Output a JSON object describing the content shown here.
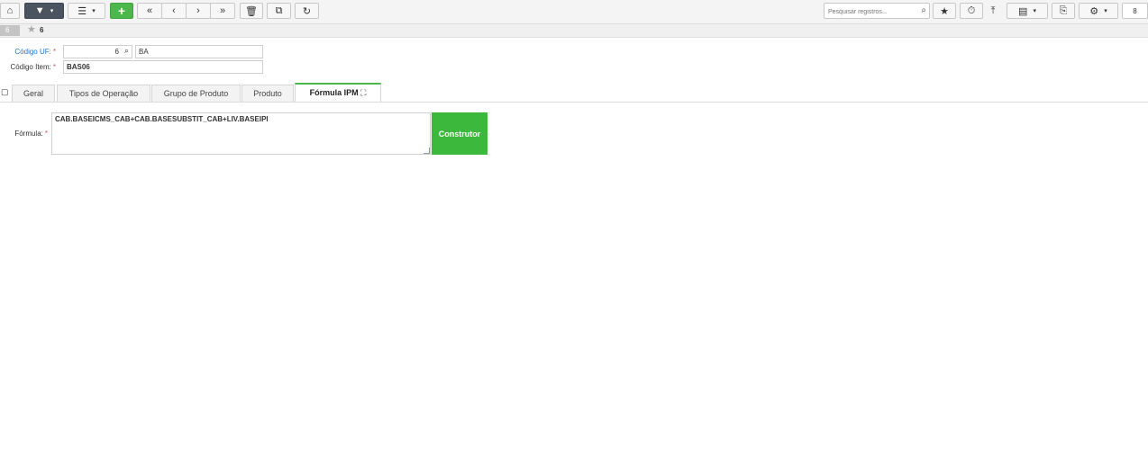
{
  "toolbar": {
    "search_placeholder": "Pesquisar registros...",
    "page_number": "8"
  },
  "subbar": {
    "record_id": "6",
    "favorite_count": "6"
  },
  "form": {
    "uf_label": "Código UF:",
    "uf_code": "6",
    "uf_name": "BA",
    "item_label": "Código Item:",
    "item_code": "BAS06",
    "required_mark": "*"
  },
  "tabs": [
    {
      "label": "Geral"
    },
    {
      "label": "Tipos de Operação"
    },
    {
      "label": "Grupo de Produto"
    },
    {
      "label": "Produto"
    },
    {
      "label": "Fórmula IPM"
    }
  ],
  "formula": {
    "label": "Fórmula:",
    "value": "CAB.BASEICMS_CAB+CAB.BASESUBSTIT_CAB+LIV.BASEIPI",
    "builder_label": "Construtor"
  },
  "colors": {
    "accent_green": "#4cb84c",
    "filter_dark": "#4a5360",
    "required_red": "#d9534f",
    "link_blue": "#1a73c8"
  }
}
